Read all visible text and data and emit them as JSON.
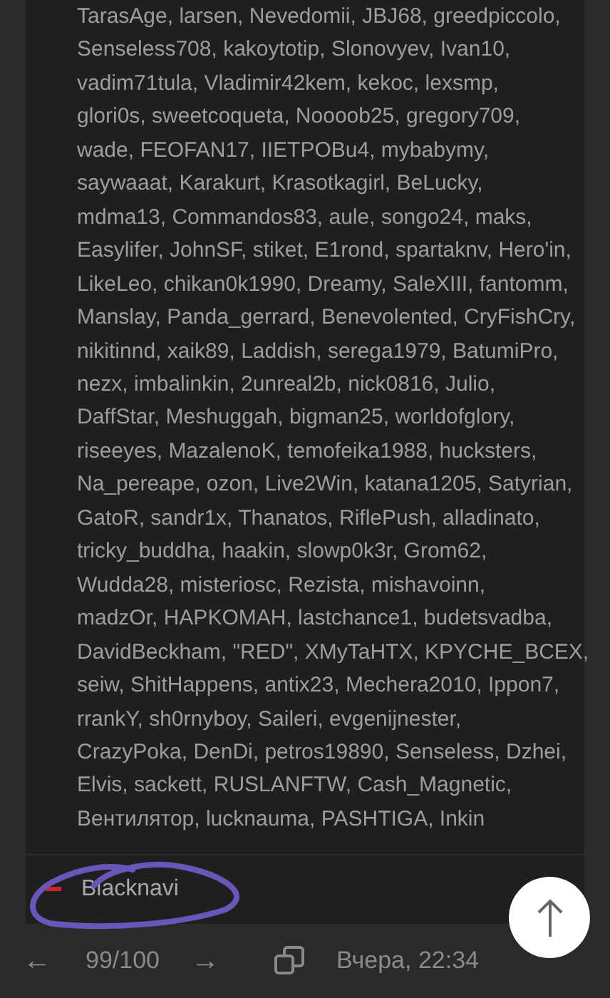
{
  "post": {
    "lines": [
      "TarasAge, larsen, Nevedomii, JBJ68, greedpiccolo,",
      "Senseless708, kakoytotip, Slonovyev, Ivan10,",
      "vadim71tula, Vladimir42kem, kekoc, lexsmp,",
      "glori0s, sweetcoqueta, Noooob25, gregory709,",
      "wade, FEOFAN17, IIETPOBu4, mybabymy,",
      "saywaaat, Karakurt, Krasotkagirl, BeLucky,",
      "mdma13, Commandos83, aule, songo24, maks,",
      "Easylifer, JohnSF, stiket, E1rond, spartaknv, Hero'in,",
      "LikeLeo, chikan0k1990, Dreamy, SaleXIII, fantomm,",
      "Manslay, Panda_gerrard, Benevolented, CryFishCry,",
      "nikitinnd, xaik89, Laddish, serega1979, BatumiPro,",
      "nezx, imbalinkin, 2unreal2b, nick0816, Julio,",
      "DaffStar, Meshuggah, bigman25, worldofglory,",
      "riseeyes, MazalenoK, temofeika1988, hucksters,",
      "Na_pereape, ozon, Live2Win, katana1205, Satyrian,",
      "GatoR, sandr1x, Thanatos, RiflePush, alladinato,",
      "tricky_buddha, haakin, slowp0k3r, Grom62,",
      "Wudda28, misteriosc, Rezista, mishavoinn,",
      "madzOr, HAPKOMAH, lastchance1, budetsvadba,",
      "DavidBeckham, \"RED\", XMyTaHTX, KPYCHE_BCEX,",
      "seiw, ShitHappens, antix23, Mechera2010, Ippon7,",
      "rrankY, sh0rnyboy, Saileri, evgenijnester,",
      "CrazyPoka, DenDi, petros19890, Senseless, Dzhei,",
      "Elvis, sackett, RUSLANFTW, Cash_Magnetic,",
      "Вентилятор, lucknauma, PASHTIGA, Inkin"
    ]
  },
  "author": {
    "name": "Blacknavi",
    "downvoted": true
  },
  "footer": {
    "prev": "←",
    "counter": "99/100",
    "next": "→",
    "time": "Вчера, 22:34"
  }
}
